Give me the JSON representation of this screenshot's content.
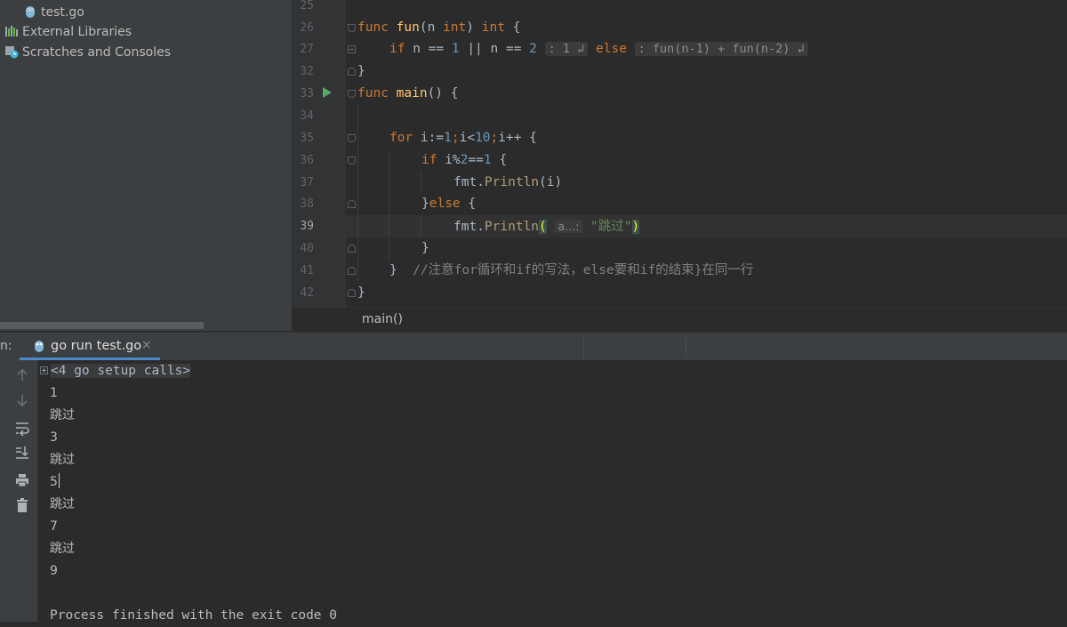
{
  "project_tree": {
    "items": [
      {
        "label": "test.go",
        "icon": "gopher-file-icon"
      },
      {
        "label": "External Libraries",
        "icon": "libraries-icon"
      },
      {
        "label": "Scratches and Consoles",
        "icon": "scratches-icon"
      }
    ]
  },
  "editor": {
    "line_numbers": [
      "25",
      "26",
      "27",
      "32",
      "33",
      "34",
      "35",
      "36",
      "37",
      "38",
      "39",
      "40",
      "41",
      "42"
    ],
    "current_line": "39",
    "code": {
      "l26": {
        "func_kw": "func",
        "name": "fun",
        "sig_a": "(n ",
        "int1": "int",
        "sig_b": ") ",
        "int2": "int",
        "sig_c": " {"
      },
      "l27": {
        "if_kw": "if",
        "cond_a": " n == ",
        "one": "1",
        "cond_b": " || n == ",
        "two": "2",
        "hint1": ": 1 ↲",
        "else_kw": "else",
        "hint2": ": fun(n-1) + fun(n-2) ↲"
      },
      "l32": "}",
      "l33": {
        "func_kw": "func",
        "name": "main",
        "rest": "() {"
      },
      "l35": {
        "for_kw": "for",
        "a": " i:=",
        "one": "1",
        "semi1": ";",
        "b": "i<",
        "ten": "10",
        "semi2": ";",
        "c": "i++ {"
      },
      "l36": {
        "if_kw": "if",
        "a": " i%",
        "two": "2",
        "b": "==",
        "one": "1",
        "c": " {"
      },
      "l37": {
        "pkg": "fmt.",
        "call": "Println",
        "args": "(i)"
      },
      "l38": {
        "brace": "}",
        "else_kw": "else",
        "rest": " {"
      },
      "l39": {
        "pkg": "fmt.",
        "call": "Println",
        "open": "(",
        "hint": "a...:",
        "str": "\"跳过\"",
        "close": ")"
      },
      "l40": "}",
      "l41": {
        "brace": "}",
        "comment": "//注意for循环和if的写法，else要和if的结束}在同一行"
      },
      "l42": "}"
    }
  },
  "breadcrumb": {
    "text": "main()"
  },
  "run_window": {
    "label": "n:",
    "tab_label": "go run test.go",
    "close_glyph": "×",
    "tools": [
      "up-arrow-icon",
      "down-arrow-icon",
      "soft-wrap-icon",
      "scroll-to-end-icon",
      "print-icon",
      "trash-icon"
    ],
    "console": {
      "setup": "<4 go setup calls>",
      "outputs": [
        "1",
        "跳过",
        "3",
        "跳过",
        "5",
        "跳过",
        "7",
        "跳过",
        "9"
      ],
      "finished": "Process finished with the exit code 0"
    }
  },
  "colors": {
    "keyword": "#cc7832",
    "function": "#ffc66d",
    "number": "#6897bb",
    "string": "#6a8759",
    "comment": "#808080",
    "run_icon": "#59a869",
    "tab_underline": "#4a88c7"
  }
}
